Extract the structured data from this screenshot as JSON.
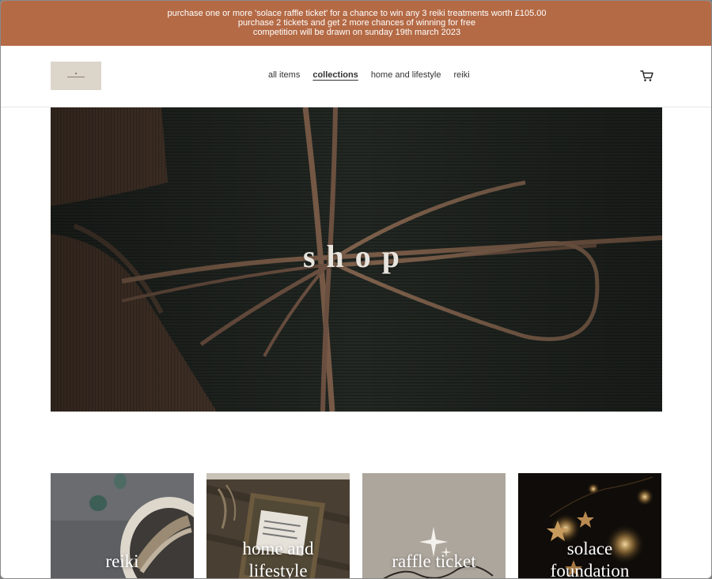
{
  "announcement": {
    "lines": [
      "purchase one or more 'solace raffle ticket' for a chance to win any 3 reiki treatments worth £105.00",
      "purchase 2 tickets and get 2 more chances of winning for free",
      "competition will be drawn on sunday 19th march 2023"
    ],
    "color": "#b46a45"
  },
  "header": {
    "nav": [
      {
        "label": "all items",
        "active": false
      },
      {
        "label": "collections",
        "active": true
      },
      {
        "label": "home and lifestyle",
        "active": false
      },
      {
        "label": "reiki",
        "active": false
      }
    ],
    "cart_icon": "cart-icon"
  },
  "hero": {
    "title": "shop"
  },
  "collections": [
    {
      "label_lines": [
        "reiki"
      ]
    },
    {
      "label_lines": [
        "home and",
        "lifestyle"
      ]
    },
    {
      "label_lines": [
        "raffle ticket"
      ]
    },
    {
      "label_lines": [
        "solace",
        "foundation"
      ]
    }
  ]
}
